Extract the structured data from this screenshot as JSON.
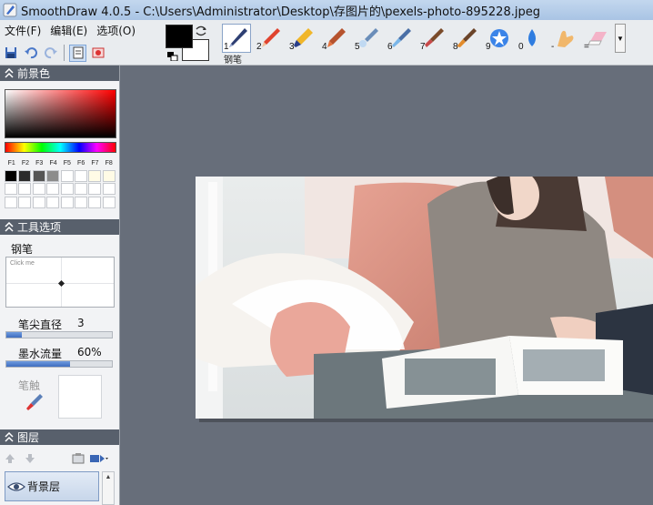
{
  "window": {
    "title": "SmoothDraw 4.0.5 - C:\\Users\\Administrator\\Desktop\\存图片的\\pexels-photo-895228.jpeg"
  },
  "menu": {
    "items": [
      {
        "label": "文件(F)"
      },
      {
        "label": "编辑(E)"
      },
      {
        "label": "选项(O)"
      }
    ]
  },
  "quick_tools": [
    "save-icon",
    "undo-icon",
    "redo-icon",
    "page-icon",
    "image-icon"
  ],
  "colors": {
    "foreground": "#000000",
    "background": "#ffffff",
    "accent": "#3f6dbf",
    "panel_header": "#58606c",
    "canvas_bg": "#676e7a"
  },
  "brushes": {
    "items": [
      {
        "num": "1",
        "icon": "pen-icon"
      },
      {
        "num": "2",
        "icon": "pencil-icon"
      },
      {
        "num": "3",
        "icon": "marker-icon"
      },
      {
        "num": "4",
        "icon": "crayon-icon"
      },
      {
        "num": "5",
        "icon": "airbrush-icon"
      },
      {
        "num": "6",
        "icon": "spray-icon"
      },
      {
        "num": "7",
        "icon": "paintbrush-icon"
      },
      {
        "num": "8",
        "icon": "brush-icon"
      },
      {
        "num": "9",
        "icon": "star-icon"
      },
      {
        "num": "0",
        "icon": "water-drop-icon"
      },
      {
        "num": "-",
        "icon": "smudge-finger-icon"
      },
      {
        "num": "=",
        "icon": "eraser-icon"
      }
    ],
    "active_caption": "钢笔"
  },
  "panels": {
    "foreground": {
      "title": "前景色",
      "f_keys": [
        "F1",
        "F2",
        "F3",
        "F4",
        "F5",
        "F6",
        "F7",
        "F8"
      ],
      "palette_row1": [
        "#000000",
        "#2b2b2b",
        "#555555",
        "#8c8c8c",
        "#ffffff",
        "#ffffff",
        "#fffbe6",
        "#fffbe6"
      ]
    },
    "tool_options": {
      "title": "工具选项",
      "tool_name": "钢笔",
      "click_hint": "Click me",
      "tip_diameter_label": "笔尖直径",
      "tip_diameter_value": "3",
      "tip_diameter_fraction": 0.15,
      "ink_flow_label": "墨水流量",
      "ink_flow_value": "60%",
      "ink_flow_fraction": 0.6,
      "smudge_label": "笔触"
    },
    "layers": {
      "title": "图层",
      "items": [
        {
          "name": "背景层",
          "visible": true
        }
      ]
    }
  }
}
